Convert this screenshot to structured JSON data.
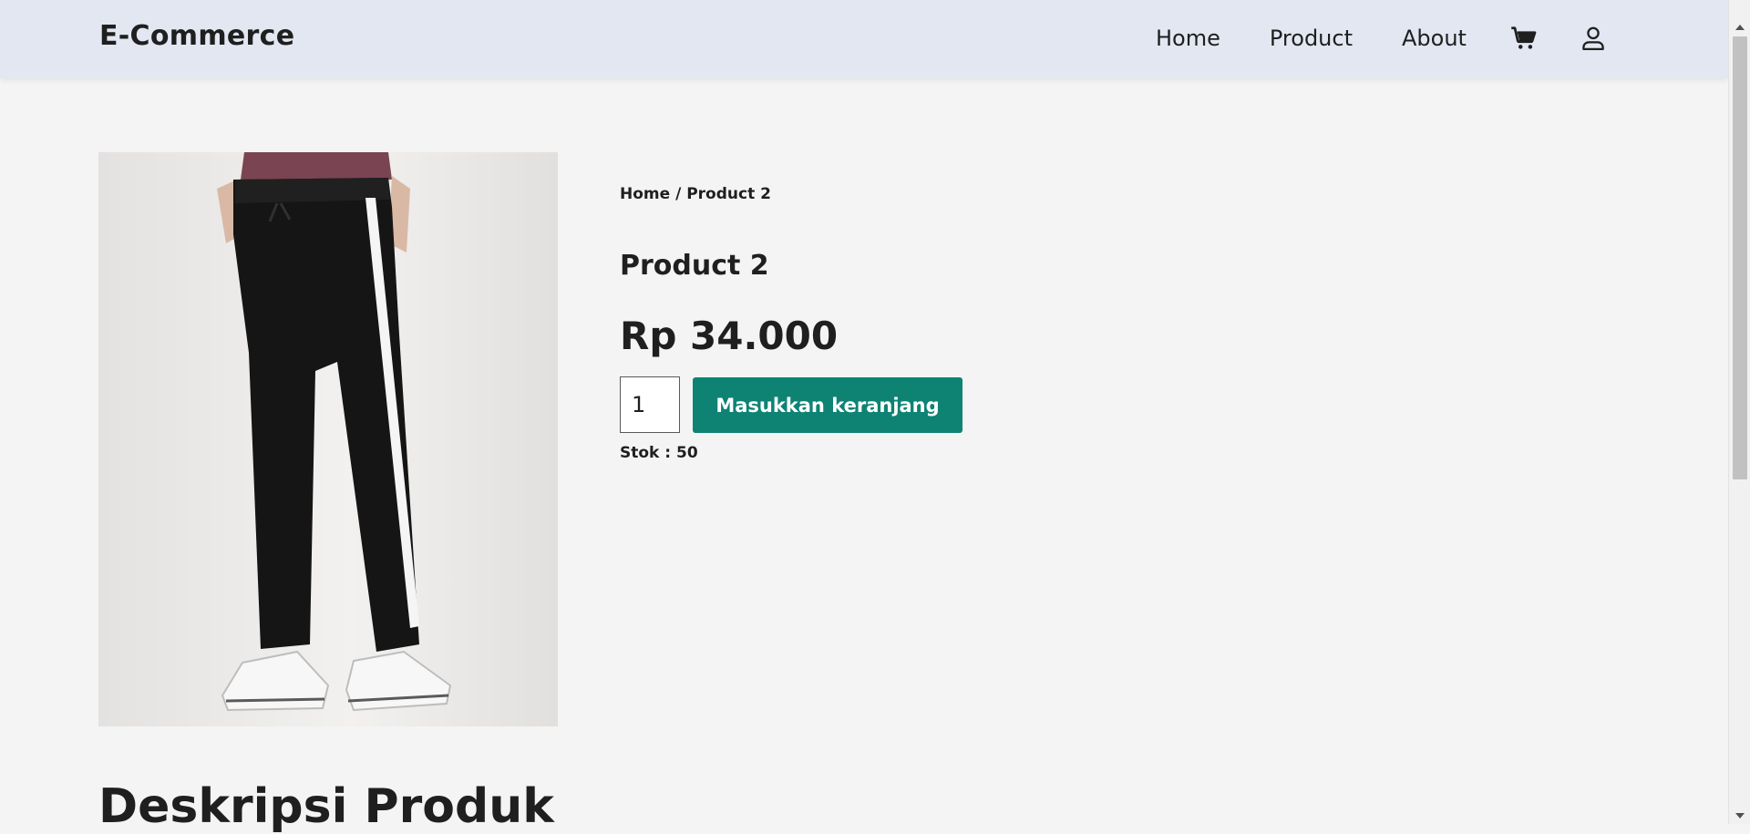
{
  "navbar": {
    "brand": "E-Commerce",
    "links": [
      "Home",
      "Product",
      "About"
    ],
    "icons": [
      "cart-icon",
      "user-icon"
    ]
  },
  "breadcrumb": {
    "home": "Home",
    "separator": " / ",
    "current": "Product 2"
  },
  "product": {
    "name": "Product 2",
    "price": "Rp 34.000",
    "quantity": "1",
    "add_to_cart_label": "Masukkan keranjang",
    "stock": "Stok : 50",
    "image_description": "black track pants with white side stripe and white sneakers"
  },
  "description": {
    "heading": "Deskripsi Produk"
  },
  "colors": {
    "navbar_bg": "#e3e7f2",
    "page_bg": "#f4f4f4",
    "accent": "#0e8374",
    "text": "#1f1f1f"
  }
}
